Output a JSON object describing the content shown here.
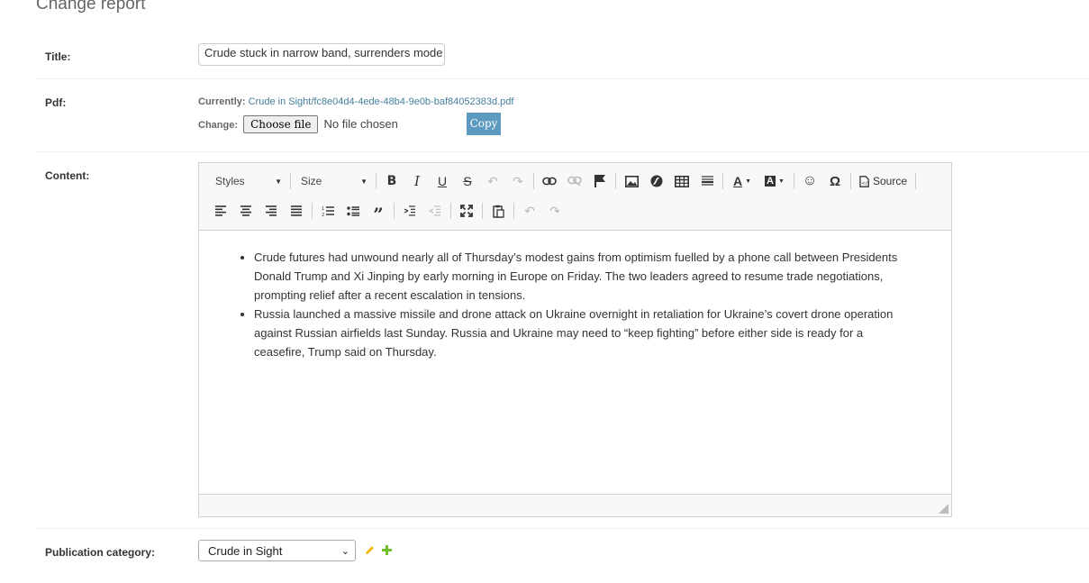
{
  "page": {
    "title": "Change report"
  },
  "title_field": {
    "label": "Title:",
    "value": "Crude stuck in narrow band, surrenders mode"
  },
  "pdf_field": {
    "label": "Pdf:",
    "currently_label": "Currently:",
    "current_file": "Crude in Sight/fc8e04d4-4ede-48b4-9e0b-baf84052383d.pdf",
    "change_label": "Change:",
    "choose_file_label": "Choose file",
    "no_file_text": "No file chosen",
    "copy_label": "Copy"
  },
  "content_field": {
    "label": "Content:",
    "toolbar": {
      "styles_label": "Styles",
      "size_label": "Size",
      "source_label": "Source"
    },
    "bullets": [
      "Crude futures had unwound nearly all of Thursday’s modest gains from optimism fuelled by a phone call between Presidents Donald Trump and Xi Jinping by early morning in Europe on Friday. The two leaders agreed to resume trade negotiations, prompting relief after a recent escalation in tensions.",
      "Russia launched a massive missile and drone attack on Ukraine overnight in retaliation for Ukraine’s covert drone operation against Russian airfields last Sunday. Russia and Ukraine may need to “keep fighting” before either side is ready for a ceasefire, Trump said on Thursday."
    ]
  },
  "publication_category": {
    "label": "Publication category:",
    "selected": "Crude in Sight"
  },
  "colors": {
    "link": "#447e9b",
    "copy_button": "#5d9ac0",
    "edit_icon": "#efb80b",
    "add_icon": "#70bf2b"
  }
}
